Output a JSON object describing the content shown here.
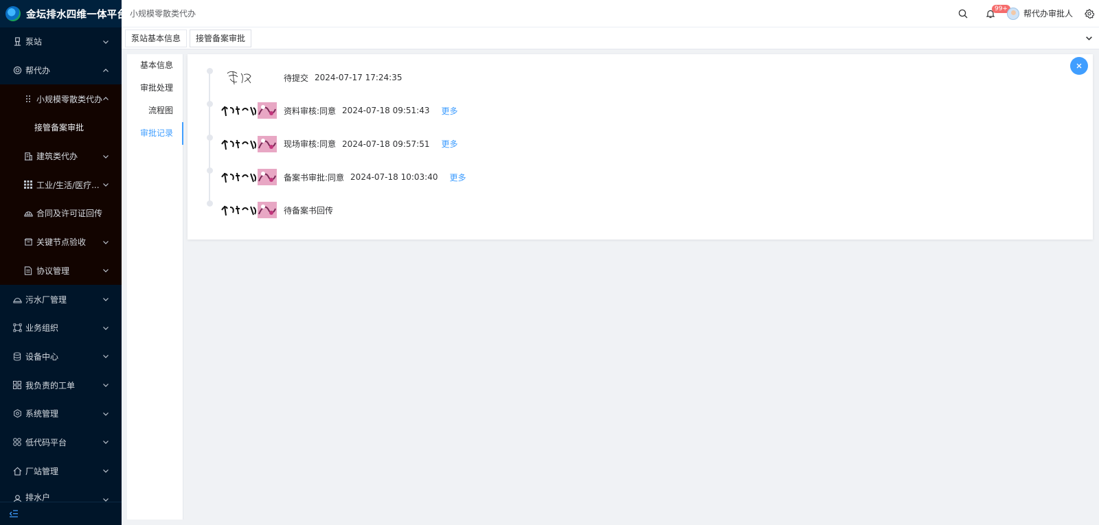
{
  "app": {
    "title": "金坛排水四维一体平台"
  },
  "sidebar": {
    "items": [
      {
        "label": "泵站",
        "icon": "pump-station-icon",
        "expanded": false
      },
      {
        "label": "帮代办",
        "icon": "service-icon",
        "expanded": true
      },
      {
        "label": "小规模零散类代办",
        "icon": "grid-dots-icon",
        "expanded": true
      },
      {
        "label": "接管备案审批",
        "icon": "",
        "active": true
      },
      {
        "label": "建筑类代办",
        "icon": "building-icon",
        "expanded": false
      },
      {
        "label": "工业/生活/医疗...",
        "icon": "apps-icon",
        "expanded": false
      },
      {
        "label": "合同及许可证回传",
        "icon": "hardhat-icon"
      },
      {
        "label": "关键节点验收",
        "icon": "box-icon",
        "expanded": false
      },
      {
        "label": "协议管理",
        "icon": "document-icon",
        "expanded": false
      },
      {
        "label": "污水厂管理",
        "icon": "hardhat-icon",
        "expanded": false
      },
      {
        "label": "业务组织",
        "icon": "org-icon",
        "expanded": false
      },
      {
        "label": "设备中心",
        "icon": "database-icon",
        "expanded": false
      },
      {
        "label": "我负责的工单",
        "icon": "dashboard-icon",
        "expanded": false
      },
      {
        "label": "系统管理",
        "icon": "settings-hex-icon",
        "expanded": false
      },
      {
        "label": "低代码平台",
        "icon": "blocks-icon",
        "expanded": false
      },
      {
        "label": "厂站管理",
        "icon": "home-icon",
        "expanded": false
      },
      {
        "label": "排水户",
        "icon": "user-group-icon",
        "expanded": false
      }
    ],
    "collapse_icon": "menu-fold-icon"
  },
  "header": {
    "breadcrumb": "小规模零散类代办",
    "notification_badge": "99+",
    "user_name": "帮代办审批人"
  },
  "tabs": [
    {
      "label": "泵站基本信息"
    },
    {
      "label": "接管备案审批",
      "active": true
    }
  ],
  "detail_tabs": [
    {
      "label": "基本信息"
    },
    {
      "label": "审批处理"
    },
    {
      "label": "流程图"
    },
    {
      "label": "审批记录",
      "active": true
    }
  ],
  "timeline": [
    {
      "status": "待提交",
      "time": "2024-07-17 17:24:35",
      "more": "",
      "signature": "handwritten"
    },
    {
      "status": "资料审核:同意",
      "time": "2024-07-18 09:51:43",
      "more": "更多",
      "signature": "stamp"
    },
    {
      "status": "现场审核:同意",
      "time": "2024-07-18 09:57:51",
      "more": "更多",
      "signature": "stamp"
    },
    {
      "status": "备案书审批:同意",
      "time": "2024-07-18 10:03:40",
      "more": "更多",
      "signature": "stamp"
    },
    {
      "status": "待备案书回传",
      "time": "",
      "more": "",
      "signature": "stamp"
    }
  ],
  "colors": {
    "sidebar_bg": "#001529",
    "submenu_bg": "#120400",
    "primary": "#409eff",
    "badge": "#f56c6c"
  }
}
